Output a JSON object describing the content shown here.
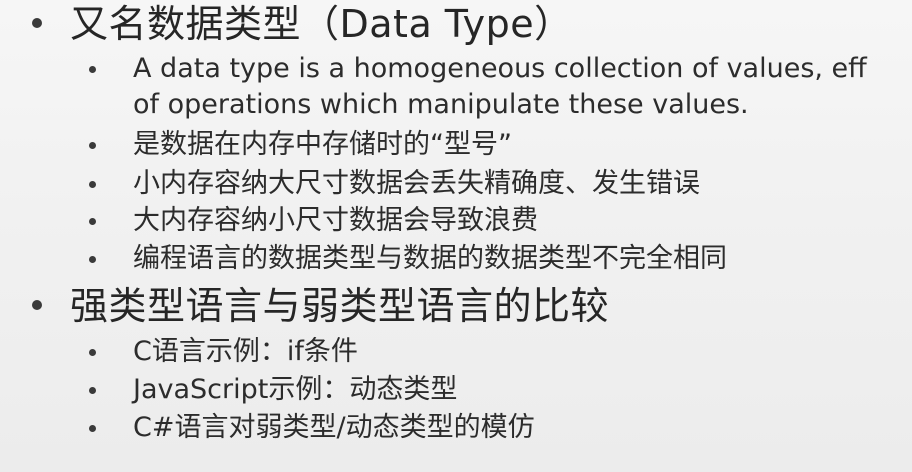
{
  "slide": {
    "sections": [
      {
        "title": "又名数据类型（Data Type）",
        "items": [
          "A data type is a homogeneous collection of values, eff",
          "of operations which manipulate these values.",
          "是数据在内存中存储时的“型号”",
          "小内存容纳大尺寸数据会丢失精确度、发生错误",
          "大内存容纳小尺寸数据会导致浪费",
          "编程语言的数据类型与数据的数据类型不完全相同"
        ]
      },
      {
        "title": "强类型语言与弱类型语言的比较",
        "items": [
          "C语言示例：if条件",
          "JavaScript示例：动态类型",
          "C#语言对弱类型/动态类型的模仿"
        ]
      }
    ]
  }
}
